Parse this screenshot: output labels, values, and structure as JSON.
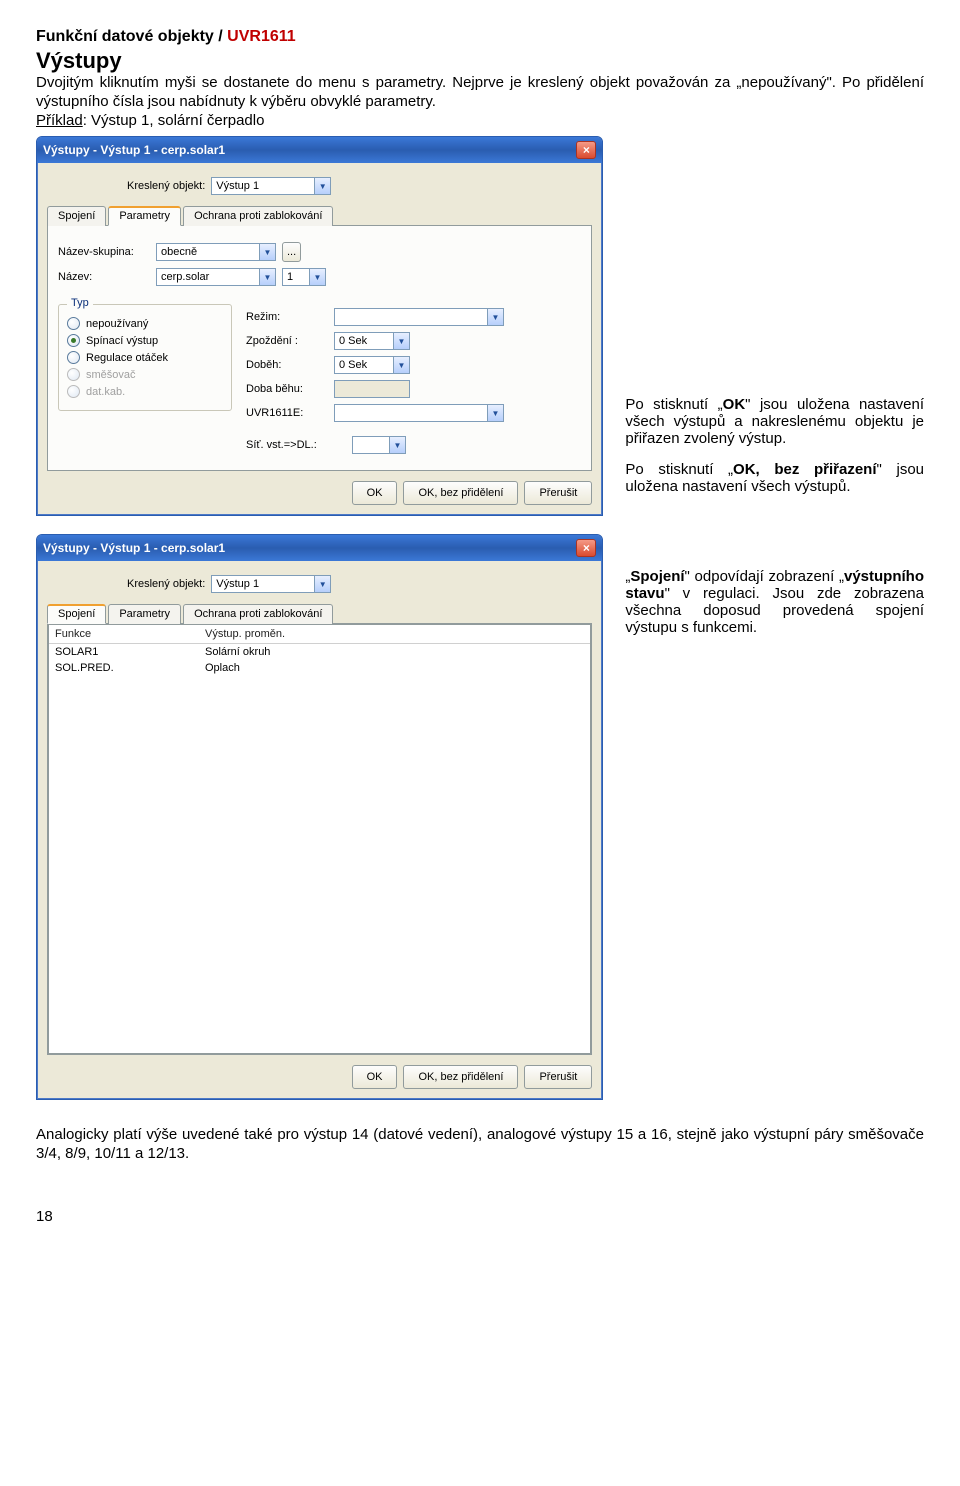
{
  "heading": {
    "prefix": "Funkční datové objekty / ",
    "model": "UVR1611"
  },
  "subheading": "Výstupy",
  "intro": "Dvojitým kliknutím myši se dostanete do menu s parametry. Nejprve je kreslený objekt považován za „nepoužívaný\". Po přidělení výstupního čísla jsou nabídnuty k výběru obvyklé parametry.",
  "example_label": "Příklad",
  "example_text": ": Výstup 1, solární čerpadlo",
  "win1": {
    "title": "Výstupy  - Výstup 1 - cerp.solar1",
    "drawn_obj_label": "Kreslený objekt:",
    "drawn_obj_value": "Výstup 1",
    "tabs": {
      "spojeni": "Spojení",
      "parametry": "Parametry",
      "ochrana": "Ochrana proti zablokování"
    },
    "name_group_label": "Název-skupina:",
    "name_group_value": "obecně",
    "name_dots": "...",
    "name_label": "Název:",
    "name_value": "cerp.solar",
    "name_index": "1",
    "group_typ": "Typ",
    "radios": {
      "nepouzivany": "nepoužívaný",
      "spinaci": "Spínací výstup",
      "regulace": "Regulace otáček",
      "smesovac": "směšovač",
      "datkab": "dat.kab."
    },
    "right": {
      "rezim_label": "Režim:",
      "zpozdeni_label": "Zpoždění :",
      "zpozdeni_value": "0 Sek",
      "dobeh_label": "Doběh:",
      "dobeh_value": "0 Sek",
      "dobabehu_label": "Doba běhu:",
      "uvr_label": "UVR1611E:",
      "sit_label": "Síť. vst.=>DL.:"
    },
    "buttons": {
      "ok": "OK",
      "ok_noassign": "OK, bez přidělení",
      "cancel": "Přerušit"
    }
  },
  "side1": {
    "p1a": "Po stisknutí „",
    "p1b": "OK",
    "p1c": "\" jsou uložena nastavení všech výstupů a nakreslenému objektu je přiřazen zvolený výstup.",
    "p2a": "Po stisknutí „",
    "p2b": "OK, bez přiřazení",
    "p2c": "\" jsou uložena nastavení všech výstupů."
  },
  "win2": {
    "title": "Výstupy  - Výstup 1 - cerp.solar1",
    "drawn_obj_label": "Kreslený objekt:",
    "drawn_obj_value": "Výstup 1",
    "cols": {
      "funkce": "Funkce",
      "vystup": "Výstup. proměn."
    },
    "rows": [
      {
        "a": "SOLAR1",
        "b": "Solární okruh"
      },
      {
        "a": "SOL.PRED.",
        "b": "Oplach"
      }
    ],
    "buttons": {
      "ok": "OK",
      "ok_noassign": "OK, bez přidělení",
      "cancel": "Přerušit"
    }
  },
  "side2": {
    "p1a": "„",
    "p1b": "Spojení",
    "p1c": "\" odpovídají zobrazení „",
    "p1d": "výstupního stavu",
    "p1e": "\" v regulaci. Jsou zde zobrazena všechna doposud provedená spojení výstupu s funkcemi."
  },
  "footer": "Analogicky platí výše uvedené také pro výstup 14 (datové vedení), analogové výstupy 15 a 16, stejně jako výstupní páry směšovače 3/4, 8/9, 10/11 a 12/13.",
  "page_number": "18"
}
